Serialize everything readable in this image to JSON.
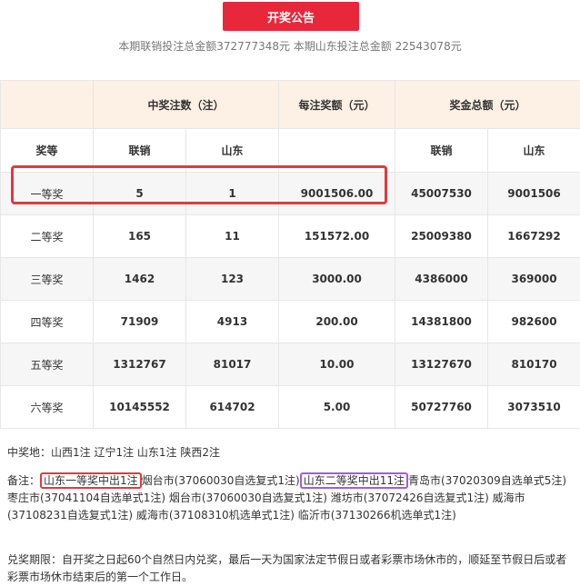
{
  "button_label": "开奖公告",
  "summary": "本期联销投注总金额372777348元 本期山东投注总金额 22543078元",
  "table": {
    "group_headers": [
      "中奖注数（注）",
      "每注奖额（元）",
      "奖金总额（元）"
    ],
    "sub_headers": [
      "奖等",
      "联销",
      "山东",
      "",
      "联销",
      "山东"
    ],
    "rows": [
      [
        "一等奖",
        "5",
        "1",
        "9001506.00",
        "45007530",
        "9001506"
      ],
      [
        "二等奖",
        "165",
        "11",
        "151572.00",
        "25009380",
        "1667292"
      ],
      [
        "三等奖",
        "1462",
        "123",
        "3000.00",
        "4386000",
        "369000"
      ],
      [
        "四等奖",
        "71909",
        "4913",
        "200.00",
        "14381800",
        "982600"
      ],
      [
        "五等奖",
        "1312767",
        "81017",
        "10.00",
        "13127670",
        "810170"
      ],
      [
        "六等奖",
        "10145552",
        "614702",
        "5.00",
        "50727760",
        "3073510"
      ]
    ]
  },
  "notes": {
    "winning_locations": "中奖地：山西1注 辽宁1注 山东1注 陕西2注",
    "remark_prefix": "备注：",
    "remark_highlight_1": "山东一等奖中出1注",
    "remark_mid": "烟台市(37060030自选复式1注)",
    "remark_highlight_2": "山东二等奖中出11注",
    "remark_rest": "青岛市(37020309自选单式5注) 枣庄市(37041104自选单式1注) 烟台市(37060030自选复式1注) 潍坊市(37072426自选复式1注) 威海市(37108231自选复式1注) 威海市(37108310机选单式1注) 临沂市(37130266机选单式1注)",
    "claim_period": "兑奖期限：自开奖之日起60个自然日内兑奖，最后一天为国家法定节假日或者彩票市场休市的，顺延至节假日后或者彩票市场休市结束后的第一个工作日。"
  },
  "colors": {
    "button": "#e8283a",
    "header_bg": "#fdf0e4",
    "highlight_red": "#e03a3f",
    "highlight_purple": "#a25ae6"
  }
}
